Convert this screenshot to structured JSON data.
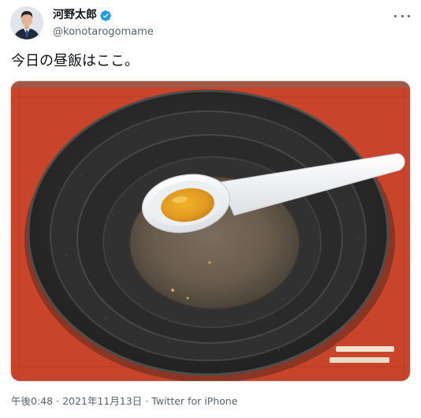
{
  "tweet": {
    "author": {
      "display_name": "河野太郎",
      "handle": "@konotarogomame",
      "verified_icon": "verified-badge-icon",
      "avatar_icon": "profile-avatar"
    },
    "more_icon": "more-options-icon",
    "text": "今日の昼飯はここ。",
    "media": {
      "description_icon": "photo-empty-ramen-bowl-with-spoon"
    },
    "meta": {
      "time": "午後0:48",
      "separator": "·",
      "date": "2021年11月13日",
      "source": "Twitter for iPhone"
    }
  },
  "colors": {
    "text_primary": "#0f1419",
    "text_secondary": "#536471",
    "verified": "#1d9bf0",
    "tray_red": "#c8442a",
    "bowl_dark": "#2b2c2b",
    "broth": "#6f6253",
    "spoon": "#f2f3f5",
    "oil_orange": "#e3a126"
  }
}
